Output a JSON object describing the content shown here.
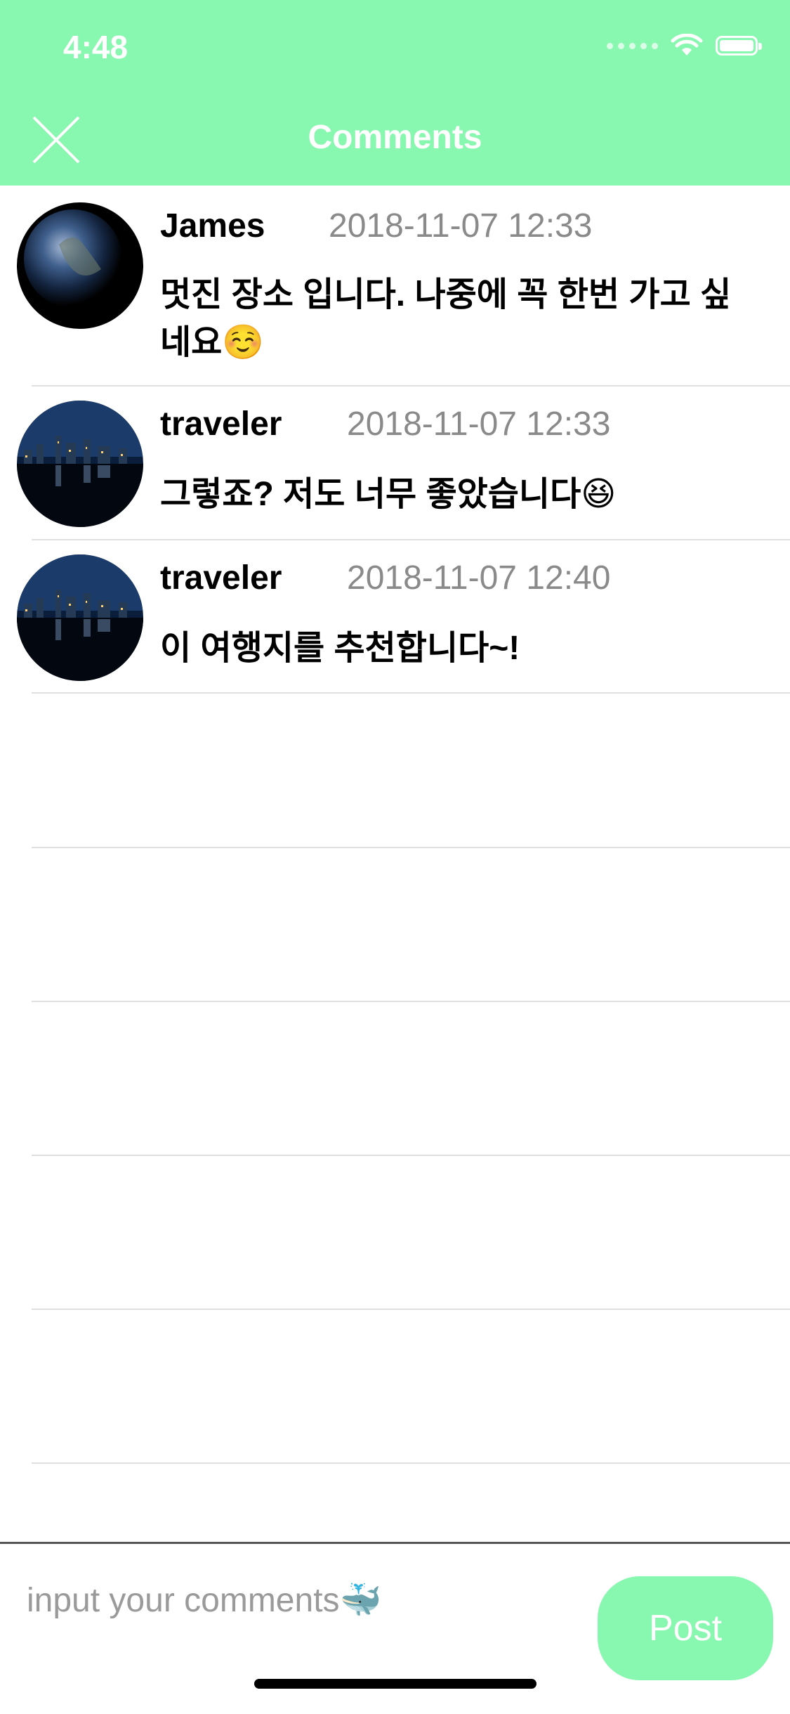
{
  "status_bar": {
    "time": "4:48"
  },
  "nav": {
    "title": "Comments",
    "close_icon": "close-x-icon"
  },
  "comments": [
    {
      "name": "James",
      "time": "2018-11-07 12:33",
      "text": "멋진 장소 입니다. 나중에 꼭 한번 가고 싶네요☺️",
      "avatar": "earth-avatar"
    },
    {
      "name": "traveler",
      "time": "2018-11-07 12:33",
      "text": "그렇죠? 저도 너무 좋았습니다😆",
      "avatar": "city-night-avatar"
    },
    {
      "name": "traveler",
      "time": "2018-11-07 12:40",
      "text": "이 여행지를 추천합니다~!",
      "avatar": "city-night-avatar"
    }
  ],
  "composer": {
    "placeholder": "input your comments🐳",
    "post_label": "Post"
  },
  "colors": {
    "accent": "#88f7b0",
    "timestamp": "#8a8a8a",
    "separator": "#e0e0e0"
  }
}
